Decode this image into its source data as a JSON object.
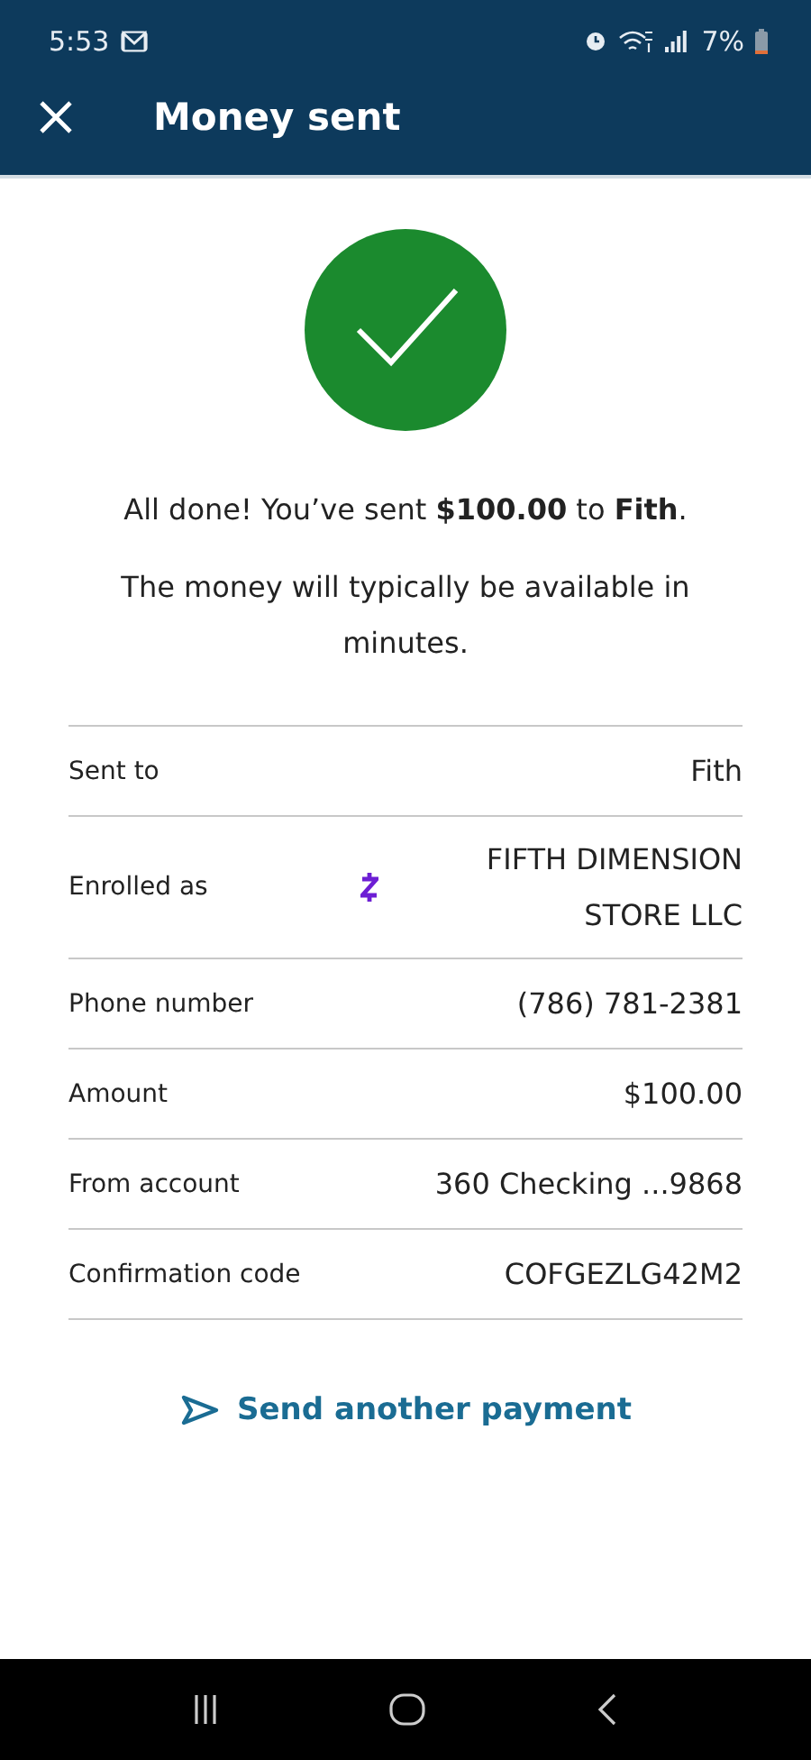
{
  "status_bar": {
    "time": "5:53",
    "battery": "7%"
  },
  "header": {
    "title": "Money sent"
  },
  "message": "All done! You’ve sent **$100.00** to **Fith**.",
  "note": "The money will typically be available in minutes.",
  "details": [
    {
      "label": "Sent to",
      "value": "Fith",
      "kind": "plain"
    },
    {
      "label": "Enrolled as",
      "value": "FIFTH DIMENSION STORE LLC",
      "kind": "zelle"
    },
    {
      "label": "Phone number",
      "value": "(786) 781-2381",
      "kind": "plain"
    },
    {
      "label": "Amount",
      "value": "$100.00",
      "kind": "plain"
    },
    {
      "label": "From account",
      "value": "360 Checking ...9868",
      "kind": "plain"
    },
    {
      "label": "Confirmation code",
      "value": "COFGEZLG42M2",
      "kind": "plain"
    }
  ],
  "action": {
    "label": "Send another payment"
  }
}
